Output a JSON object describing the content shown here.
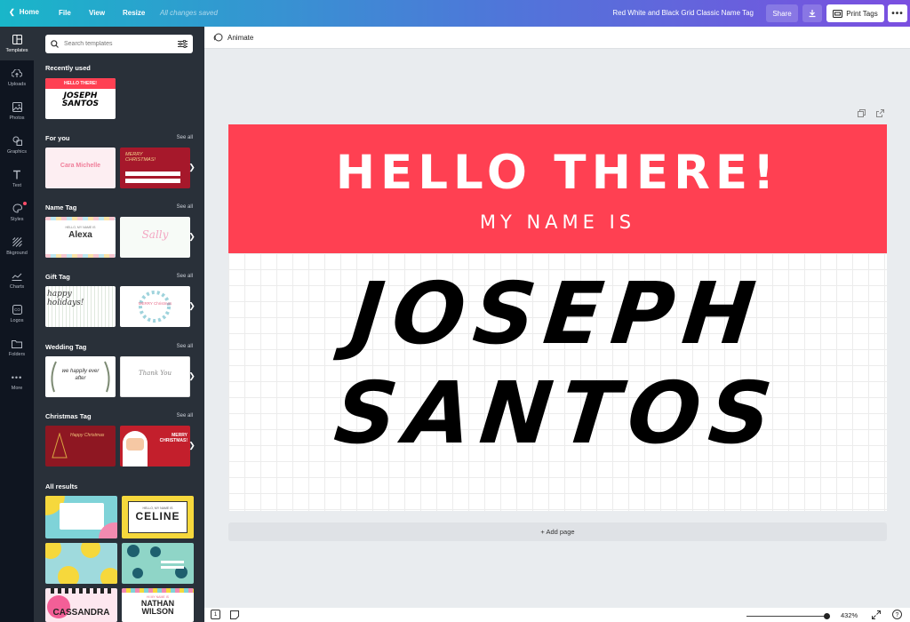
{
  "topbar": {
    "home": "Home",
    "file": "File",
    "view": "View",
    "resize": "Resize",
    "saved": "All changes saved",
    "title": "Red White and Black Grid Classic Name Tag",
    "share": "Share",
    "print": "Print Tags",
    "more": "•••"
  },
  "rail": [
    {
      "label": "Templates",
      "icon": "templates-icon"
    },
    {
      "label": "Uploads",
      "icon": "upload-icon"
    },
    {
      "label": "Photos",
      "icon": "photos-icon"
    },
    {
      "label": "Graphics",
      "icon": "graphics-icon"
    },
    {
      "label": "Text",
      "icon": "text-icon"
    },
    {
      "label": "Styles",
      "icon": "styles-icon"
    },
    {
      "label": "Bkground",
      "icon": "background-icon"
    },
    {
      "label": "Charts",
      "icon": "charts-icon"
    },
    {
      "label": "Logos",
      "icon": "logos-icon"
    },
    {
      "label": "Folders",
      "icon": "folders-icon"
    },
    {
      "label": "More",
      "icon": "more-icon"
    }
  ],
  "panel": {
    "search_placeholder": "Search templates",
    "see_all": "See all",
    "sections": {
      "recent": "Recently used",
      "foryou": "For you",
      "nametag": "Name Tag",
      "gifttag": "Gift Tag",
      "wedding": "Wedding Tag",
      "christmas": "Christmas Tag",
      "all": "All results"
    },
    "thumbs": {
      "recent_top": "HELLO THERE!",
      "recent_name": "JOSEPH SANTOS",
      "fy1": "Cara Michelle",
      "fy2": "MERRY CHRISTMAS!",
      "nt1_small": "HELLO, MY NAME IS",
      "nt1": "Alexa",
      "nt2": "Sally",
      "gt1": "happy holidays!",
      "gt2": "MERRY Christmas",
      "wt1": "we happily ever after",
      "wt2": "Thank You",
      "ct1": "Happy Christmas",
      "ct2": "MERRY CHRISTMAS!",
      "ar2_small": "HELLO, MY NAME IS",
      "ar2": "CELINE",
      "ar5": "CASSANDRA",
      "ar6_small": "HI MY NAME IS",
      "ar6": "NATHAN WILSON"
    }
  },
  "workspace": {
    "animate": "Animate",
    "add_page": "+ Add page",
    "zoom": "432%",
    "page_number": "1"
  },
  "canvas": {
    "headline": "HELLO THERE!",
    "subline": "MY NAME IS",
    "first_name": "JOSEPH",
    "last_name": "SANTOS",
    "banner_color": "#ff4052"
  }
}
